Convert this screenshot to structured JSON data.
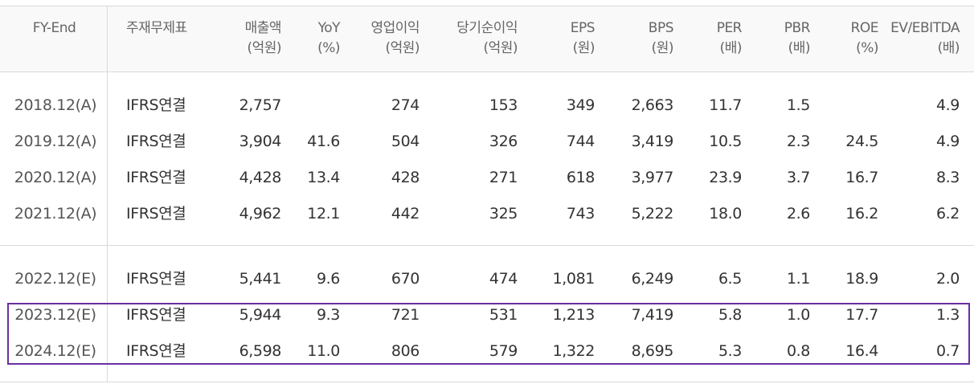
{
  "headers": [
    {
      "line1": "FY-End",
      "line2": ""
    },
    {
      "line1": "주재무제표",
      "line2": ""
    },
    {
      "line1": "매출액",
      "line2": "(억원)"
    },
    {
      "line1": "YoY",
      "line2": "(%)"
    },
    {
      "line1": "영업이익",
      "line2": "(억원)"
    },
    {
      "line1": "당기순이익",
      "line2": "(억원)"
    },
    {
      "line1": "EPS",
      "line2": "(원)"
    },
    {
      "line1": "BPS",
      "line2": "(원)"
    },
    {
      "line1": "PER",
      "line2": "(배)"
    },
    {
      "line1": "PBR",
      "line2": "(배)"
    },
    {
      "line1": "ROE",
      "line2": "(%)"
    },
    {
      "line1": "EV/EBITDA",
      "line2": "(배)"
    }
  ],
  "rows": [
    [
      "2018.12(A)",
      "IFRS연결",
      "2,757",
      "",
      "274",
      "153",
      "349",
      "2,663",
      "11.7",
      "1.5",
      "",
      "4.9"
    ],
    [
      "2019.12(A)",
      "IFRS연결",
      "3,904",
      "41.6",
      "504",
      "326",
      "744",
      "3,419",
      "10.5",
      "2.3",
      "24.5",
      "4.9"
    ],
    [
      "2020.12(A)",
      "IFRS연결",
      "4,428",
      "13.4",
      "428",
      "271",
      "618",
      "3,977",
      "23.9",
      "3.7",
      "16.7",
      "8.3"
    ],
    [
      "2021.12(A)",
      "IFRS연결",
      "4,962",
      "12.1",
      "442",
      "325",
      "743",
      "5,222",
      "18.0",
      "2.6",
      "16.2",
      "6.2"
    ],
    [
      "2022.12(E)",
      "IFRS연결",
      "5,441",
      "9.6",
      "670",
      "474",
      "1,081",
      "6,249",
      "6.5",
      "1.1",
      "18.9",
      "2.0"
    ],
    [
      "2023.12(E)",
      "IFRS연결",
      "5,944",
      "9.3",
      "721",
      "531",
      "1,213",
      "7,419",
      "5.8",
      "1.0",
      "17.7",
      "1.3"
    ],
    [
      "2024.12(E)",
      "IFRS연결",
      "6,598",
      "11.0",
      "806",
      "579",
      "1,322",
      "8,695",
      "5.3",
      "0.8",
      "16.4",
      "0.7"
    ]
  ],
  "colors": {
    "highlight_border": "#6a2fa2",
    "grid": "#d9d9d9",
    "header_bg": "#f9f9f9"
  }
}
